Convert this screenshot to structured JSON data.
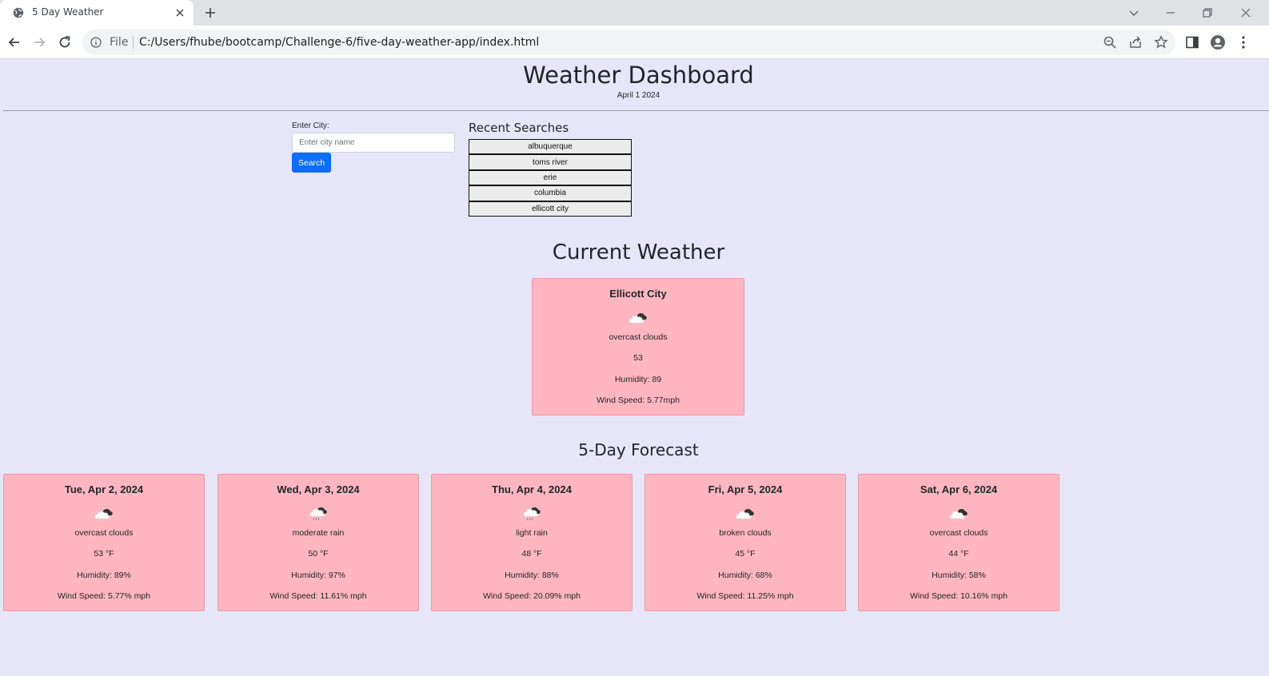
{
  "browser": {
    "tab_title": "5 Day Weather",
    "scheme_label": "File",
    "url": "C:/Users/fhube/bootcamp/Challenge-6/five-day-weather-app/index.html"
  },
  "header": {
    "title": "Weather Dashboard",
    "date": "April 1 2024"
  },
  "search": {
    "label": "Enter City:",
    "placeholder": "Enter city name",
    "value": "",
    "button_label": "Search"
  },
  "recent": {
    "title": "Recent Searches",
    "items": [
      "albuquerque",
      "toms river",
      "erie",
      "columbia",
      "ellicott city"
    ]
  },
  "current": {
    "title": "Current Weather",
    "city": "Ellicott City",
    "icon": "cloud-icon",
    "description": "overcast clouds",
    "temp": "53",
    "humidity": "Humidity: 89",
    "wind": "Wind Speed: 5.77mph"
  },
  "forecast": {
    "title": "5-Day Forecast",
    "days": [
      {
        "date": "Tue, Apr 2, 2024",
        "icon": "cloud-icon",
        "description": "overcast clouds",
        "temp": "53 °F",
        "humidity": "Humidity: 89%",
        "wind": "Wind Speed: 5.77% mph"
      },
      {
        "date": "Wed, Apr 3, 2024",
        "icon": "rain-cloud-icon",
        "description": "moderate rain",
        "temp": "50 °F",
        "humidity": "Humidity: 97%",
        "wind": "Wind Speed: 11.61% mph"
      },
      {
        "date": "Thu, Apr 4, 2024",
        "icon": "rain-cloud-icon",
        "description": "light rain",
        "temp": "48 °F",
        "humidity": "Humidity: 88%",
        "wind": "Wind Speed: 20.09% mph"
      },
      {
        "date": "Fri, Apr 5, 2024",
        "icon": "cloud-icon",
        "description": "broken clouds",
        "temp": "45 °F",
        "humidity": "Humidity: 68%",
        "wind": "Wind Speed: 11.25% mph"
      },
      {
        "date": "Sat, Apr 6, 2024",
        "icon": "cloud-icon",
        "description": "overcast clouds",
        "temp": "44 °F",
        "humidity": "Humidity: 58%",
        "wind": "Wind Speed: 10.16% mph"
      }
    ]
  },
  "colors": {
    "background": "#e6e6f8",
    "card": "#ffb6c1",
    "button": "#0d6efd"
  }
}
